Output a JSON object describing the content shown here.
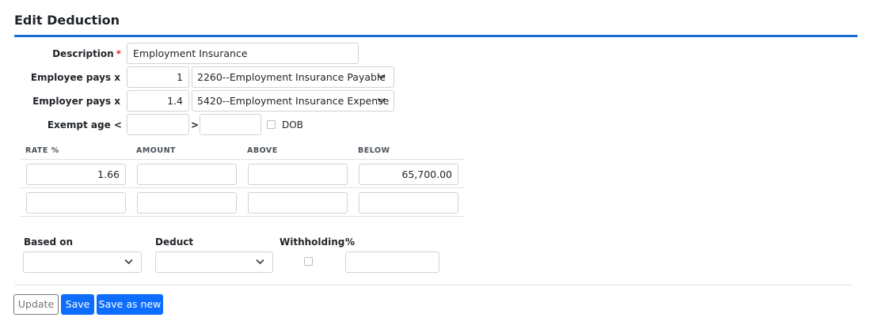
{
  "header": {
    "title": "Edit Deduction"
  },
  "form": {
    "description": {
      "label": "Description",
      "required_mark": "*",
      "value": "Employment Insurance"
    },
    "employee_pays": {
      "label": "Employee pays x",
      "multiplier": "1",
      "account": "2260--Employment Insurance Payable"
    },
    "employer_pays": {
      "label": "Employer pays x",
      "multiplier": "1.4",
      "account": "5420--Employment Insurance Expense"
    },
    "exempt_age": {
      "label": "Exempt age <",
      "min": "",
      "gt_label": ">",
      "max": "",
      "dob_label": "DOB",
      "dob_checked": false
    }
  },
  "rates_table": {
    "headers": [
      "RATE %",
      "AMOUNT",
      "ABOVE",
      "BELOW"
    ],
    "rows": [
      {
        "rate": "1.66",
        "amount": "",
        "above": "",
        "below": "65,700.00"
      },
      {
        "rate": "",
        "amount": "",
        "above": "",
        "below": ""
      }
    ]
  },
  "options": {
    "based_on": {
      "label": "Based on",
      "value": ""
    },
    "deduct": {
      "label": "Deduct",
      "value": ""
    },
    "withholding": {
      "label": "Withholding",
      "checked": false
    },
    "percent": {
      "label": "%",
      "value": ""
    }
  },
  "buttons": {
    "update": "Update",
    "save": "Save",
    "save_as_new": "Save as new"
  },
  "colors": {
    "accent": "#1a6fd6",
    "primary_button": "#0d6efd",
    "required": "#dc3545"
  }
}
